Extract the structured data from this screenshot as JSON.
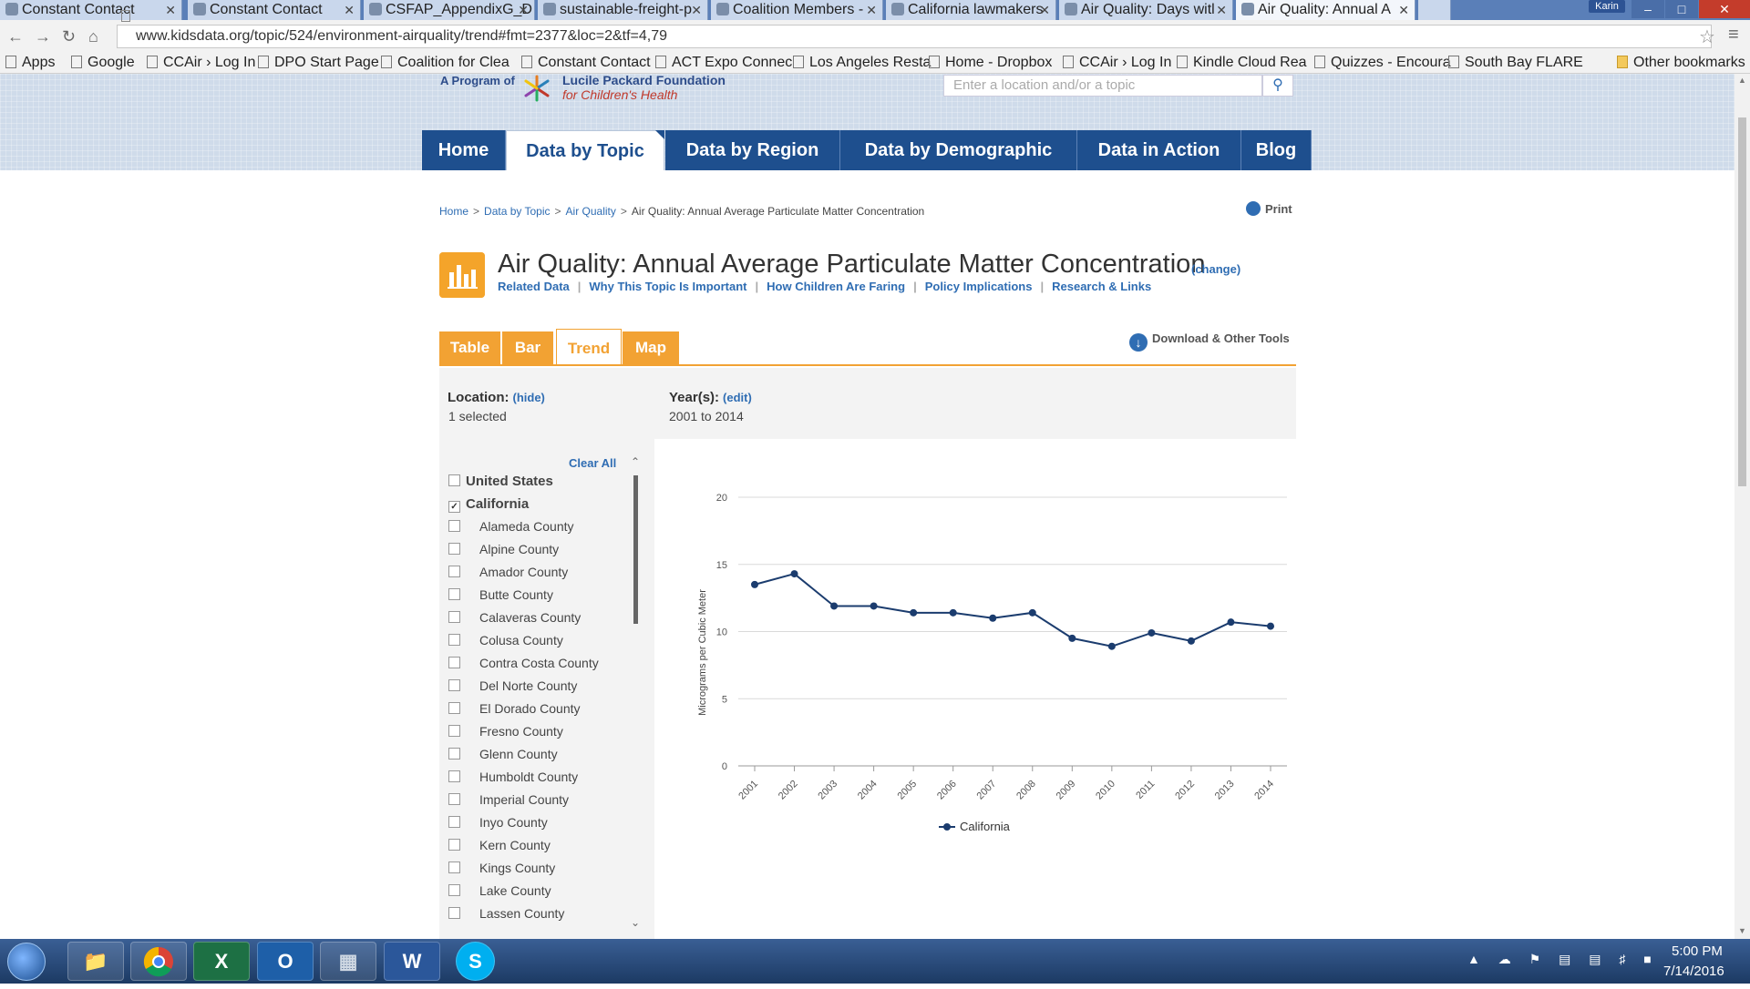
{
  "browser": {
    "tabs": [
      {
        "title": "Constant Contact"
      },
      {
        "title": "Constant Contact"
      },
      {
        "title": "CSFAP_AppendixG_D"
      },
      {
        "title": "sustainable-freight-p"
      },
      {
        "title": "Coalition Members -"
      },
      {
        "title": "California lawmakers"
      },
      {
        "title": "Air Quality: Days witl"
      },
      {
        "title": "Air Quality: Annual A"
      }
    ],
    "user_badge": "Karin",
    "url": "www.kidsdata.org/topic/524/environment-airquality/trend#fmt=2377&loc=2&tf=4,79",
    "bookmarks": [
      "Apps",
      "Google",
      "CCAir › Log In",
      "DPO Start Page",
      "Coalition for Clea",
      "Constant Contact",
      "ACT Expo Connec",
      "Los Angeles Resta",
      "Home - Dropbox",
      "CCAir › Log In",
      "Kindle Cloud Rea",
      "Quizzes - Encoura",
      "South Bay FLARE"
    ],
    "other_bookmarks": "Other bookmarks"
  },
  "site": {
    "program_of": "A Program of",
    "org_name": "Lucile Packard Foundation",
    "org_sub": "for Children's Health",
    "search_placeholder": "Enter a location and/or a topic",
    "nav": [
      "Home",
      "Data by Topic",
      "Data by Region",
      "Data by Demographic",
      "Data in Action",
      "Blog"
    ],
    "active_nav": "Data by Topic"
  },
  "breadcrumb": {
    "items": [
      "Home",
      "Data by Topic",
      "Air Quality"
    ],
    "current": "Air Quality: Annual Average Particulate Matter Concentration"
  },
  "print_label": "Print",
  "page": {
    "title": "Air Quality: Annual Average Particulate Matter Concentration",
    "change": "(change)",
    "subnav": [
      "Related Data",
      "Why This Topic Is Important",
      "How Children Are Faring",
      "Policy Implications",
      "Research & Links"
    ],
    "view_tabs": [
      "Table",
      "Bar",
      "Trend",
      "Map"
    ],
    "active_view": "Trend",
    "download": "Download & Other Tools"
  },
  "filters": {
    "location_label": "Location:",
    "location_action": "(hide)",
    "location_value": "1 selected",
    "years_label": "Year(s):",
    "years_action": "(edit)",
    "years_value": "2001 to 2014",
    "clear_all": "Clear All"
  },
  "locations": [
    {
      "name": "United States",
      "checked": false,
      "level": "top"
    },
    {
      "name": "California",
      "checked": true,
      "level": "top"
    },
    {
      "name": "Alameda County",
      "checked": false,
      "level": "county"
    },
    {
      "name": "Alpine County",
      "checked": false,
      "level": "county"
    },
    {
      "name": "Amador County",
      "checked": false,
      "level": "county"
    },
    {
      "name": "Butte County",
      "checked": false,
      "level": "county"
    },
    {
      "name": "Calaveras County",
      "checked": false,
      "level": "county"
    },
    {
      "name": "Colusa County",
      "checked": false,
      "level": "county"
    },
    {
      "name": "Contra Costa County",
      "checked": false,
      "level": "county"
    },
    {
      "name": "Del Norte County",
      "checked": false,
      "level": "county"
    },
    {
      "name": "El Dorado County",
      "checked": false,
      "level": "county"
    },
    {
      "name": "Fresno County",
      "checked": false,
      "level": "county"
    },
    {
      "name": "Glenn County",
      "checked": false,
      "level": "county"
    },
    {
      "name": "Humboldt County",
      "checked": false,
      "level": "county"
    },
    {
      "name": "Imperial County",
      "checked": false,
      "level": "county"
    },
    {
      "name": "Inyo County",
      "checked": false,
      "level": "county"
    },
    {
      "name": "Kern County",
      "checked": false,
      "level": "county"
    },
    {
      "name": "Kings County",
      "checked": false,
      "level": "county"
    },
    {
      "name": "Lake County",
      "checked": false,
      "level": "county"
    },
    {
      "name": "Lassen County",
      "checked": false,
      "level": "county"
    }
  ],
  "chart_data": {
    "type": "line",
    "x": [
      "2001",
      "2002",
      "2003",
      "2004",
      "2005",
      "2006",
      "2007",
      "2008",
      "2009",
      "2010",
      "2011",
      "2012",
      "2013",
      "2014"
    ],
    "series": [
      {
        "name": "California",
        "color": "#1b3c6e",
        "values": [
          13.5,
          14.3,
          11.9,
          11.9,
          11.4,
          11.4,
          11.0,
          11.4,
          9.5,
          8.9,
          9.9,
          9.3,
          10.7,
          10.4
        ]
      }
    ],
    "ylabel": "Micrograms per Cubic Meter",
    "ylim": [
      0,
      20
    ],
    "yticks": [
      0,
      5,
      10,
      15,
      20
    ],
    "grid": true,
    "legend": "bottom"
  },
  "taskbar": {
    "apps": [
      "explorer",
      "chrome",
      "excel",
      "outlook",
      "calculator",
      "word",
      "skype"
    ],
    "time": "5:00 PM",
    "date": "7/14/2016"
  }
}
